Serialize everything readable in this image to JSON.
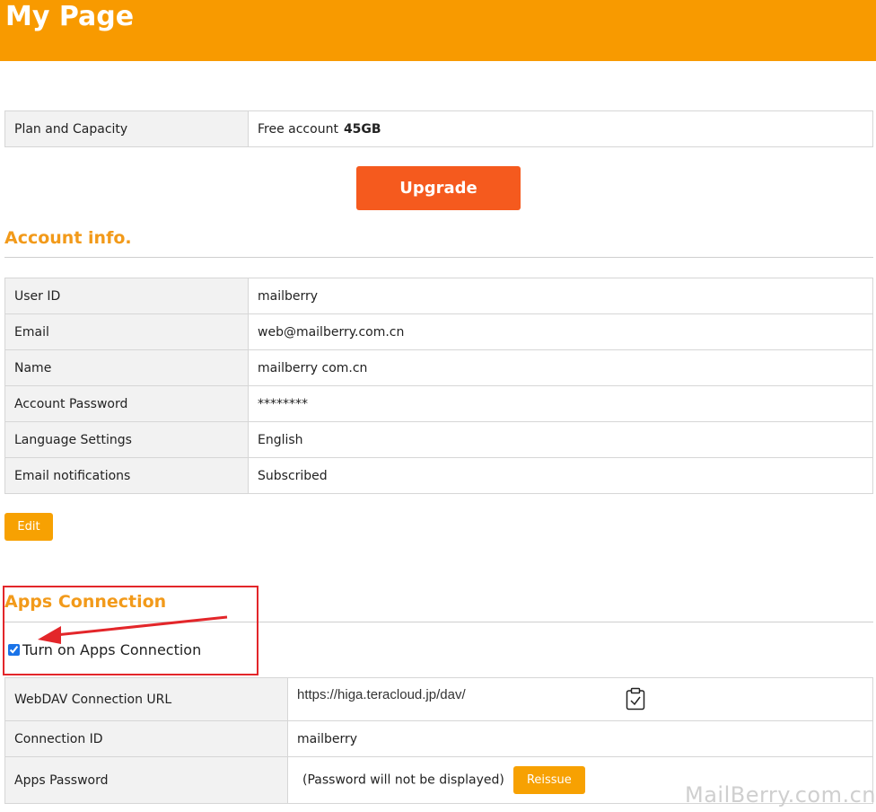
{
  "header": {
    "title": "My Page"
  },
  "plan": {
    "label": "Plan and Capacity",
    "account_type": "Free account",
    "capacity": "45GB",
    "upgrade_label": "Upgrade"
  },
  "account": {
    "title": "Account info.",
    "rows": [
      {
        "label": "User ID",
        "value": "mailberry"
      },
      {
        "label": "Email",
        "value": "web@mailberry.com.cn"
      },
      {
        "label": "Name",
        "value": "mailberry com.cn"
      },
      {
        "label": "Account Password",
        "value": "********"
      },
      {
        "label": "Language Settings",
        "value": "English"
      },
      {
        "label": "Email notifications",
        "value": "Subscribed"
      }
    ],
    "edit_label": "Edit"
  },
  "apps": {
    "title": "Apps Connection",
    "toggle_label": "Turn on Apps Connection",
    "toggle_checked": true,
    "webdav_label": "WebDAV Connection URL",
    "webdav_url": "https://higa.teracloud.jp/dav/",
    "connection_id_label": "Connection ID",
    "connection_id": "mailberry",
    "password_label": "Apps Password",
    "password_note": "(Password will not be displayed)",
    "reissue_label": "Reissue"
  },
  "watermark": "MailBerry.com.cn",
  "colors": {
    "header_bg": "#f89a00",
    "upgrade_bg": "#f55a1e",
    "button_bg": "#f7a102",
    "section_title": "#f29a1a",
    "highlight_border": "#e3262a"
  },
  "icons": [
    "clipboard-check-icon",
    "red-arrow-annotation"
  ]
}
